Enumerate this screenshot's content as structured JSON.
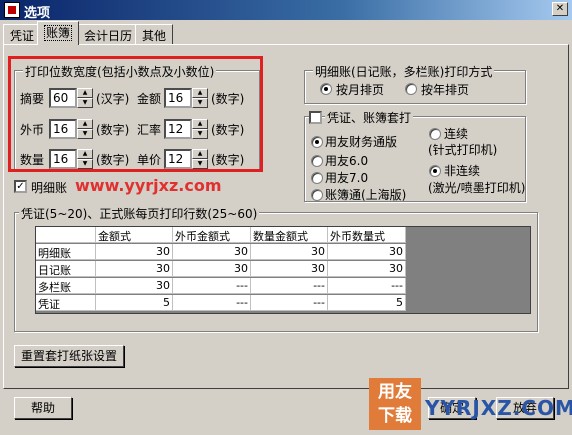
{
  "window": {
    "title": "选项",
    "close_glyph": "✕"
  },
  "tabs": [
    "凭证",
    "账簿",
    "会计日历",
    "其他"
  ],
  "print_width": {
    "title": "打印位数宽度(包括小数点及小数位)",
    "rows": [
      {
        "left_label": "摘要",
        "left_value": "60",
        "left_unit": "(汉字)",
        "right_label": "金额",
        "right_value": "16",
        "right_unit": "(数字)"
      },
      {
        "left_label": "外币",
        "left_value": "16",
        "left_unit": "(数字)",
        "right_label": "汇率",
        "right_value": "12",
        "right_unit": "(数字)"
      },
      {
        "left_label": "数量",
        "left_value": "16",
        "left_unit": "(数字)",
        "right_label": "单价",
        "right_value": "12",
        "right_unit": "(数字)"
      }
    ]
  },
  "ledger_print": {
    "title": "明细账(日记账，多栏账)打印方式",
    "by_month": "按月排页",
    "by_year": "按年排页"
  },
  "voucher_print": {
    "title": "凭证、账簿套打",
    "options": [
      "用友财务通版",
      "用友6.0",
      "用友7.0",
      "账簿通(上海版)"
    ],
    "continuous": "连续",
    "continuous_note": "(针式打印机)",
    "non_continuous": "非连续",
    "non_continuous_note": "(激光/喷墨打印机)"
  },
  "checkbox": {
    "label_prefix": "明细账",
    "checked_glyph": "✓"
  },
  "watermark_text": "www.yyrjxz.com",
  "rows_per_page": {
    "title": "凭证(5~20)、正式账每页打印行数(25~60)",
    "columns": [
      "",
      "金额式",
      "外币金额式",
      "数量金额式",
      "外币数量式"
    ],
    "rows": [
      [
        "明细账",
        "30",
        "30",
        "30",
        "30"
      ],
      [
        "日记账",
        "30",
        "30",
        "30",
        "30"
      ],
      [
        "多栏账",
        "30",
        "---",
        "---",
        "---"
      ],
      [
        "凭证",
        "5",
        "---",
        "---",
        "5"
      ]
    ]
  },
  "buttons": {
    "reset": "重置套打纸张设置",
    "help": "帮助",
    "ok": "确定",
    "cancel": "放弃"
  },
  "logo": {
    "line1": "用友",
    "line2": "下载"
  },
  "footer_url": "YYRJXZ.COM"
}
